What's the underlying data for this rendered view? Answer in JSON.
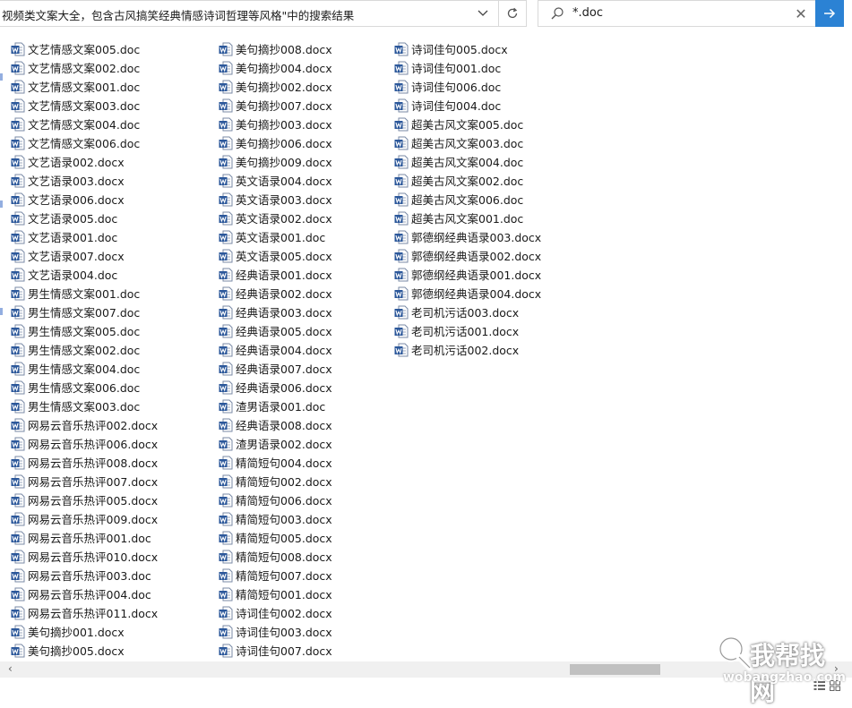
{
  "address_bar": {
    "path_text": "视频类文案大全，包含古风搞笑经典情感诗词哲理等风格\"中的搜索结果",
    "dropdown_icon": "chevron-down-icon",
    "refresh_icon": "refresh-icon"
  },
  "search": {
    "icon": "search-icon",
    "query": "*.doc",
    "clear_icon": "close-icon",
    "go_icon": "arrow-right-icon",
    "go_color": "#2b82d4"
  },
  "file_icon": {
    "name": "word-document-icon",
    "color": "#2b579a"
  },
  "columns": [
    {
      "files": [
        "文艺情感文案005.doc",
        "文艺情感文案002.doc",
        "文艺情感文案001.doc",
        "文艺情感文案003.doc",
        "文艺情感文案004.doc",
        "文艺情感文案006.doc",
        "文艺语录002.docx",
        "文艺语录003.docx",
        "文艺语录006.docx",
        "文艺语录005.doc",
        "文艺语录001.doc",
        "文艺语录007.docx",
        "文艺语录004.doc",
        "男生情感文案001.doc",
        "男生情感文案007.doc",
        "男生情感文案005.doc",
        "男生情感文案002.doc",
        "男生情感文案004.doc",
        "男生情感文案006.doc",
        "男生情感文案003.doc",
        "网易云音乐热评002.docx",
        "网易云音乐热评006.docx",
        "网易云音乐热评008.docx",
        "网易云音乐热评007.docx",
        "网易云音乐热评005.docx",
        "网易云音乐热评009.docx",
        "网易云音乐热评001.doc",
        "网易云音乐热评010.docx",
        "网易云音乐热评003.doc",
        "网易云音乐热评004.doc",
        "网易云音乐热评011.docx",
        "美句摘抄001.docx",
        "美句摘抄005.docx"
      ]
    },
    {
      "files": [
        "美句摘抄008.docx",
        "美句摘抄004.docx",
        "美句摘抄002.docx",
        "美句摘抄007.docx",
        "美句摘抄003.docx",
        "美句摘抄006.docx",
        "美句摘抄009.docx",
        "英文语录004.docx",
        "英文语录003.docx",
        "英文语录002.docx",
        "英文语录001.doc",
        "英文语录005.docx",
        "经典语录001.docx",
        "经典语录002.docx",
        "经典语录003.docx",
        "经典语录005.docx",
        "经典语录004.docx",
        "经典语录007.docx",
        "经典语录006.docx",
        "渣男语录001.doc",
        "经典语录008.docx",
        "渣男语录002.docx",
        "精简短句004.docx",
        "精简短句002.docx",
        "精简短句006.docx",
        "精简短句003.docx",
        "精简短句005.docx",
        "精简短句008.docx",
        "精简短句007.docx",
        "精简短句001.docx",
        "诗词佳句002.docx",
        "诗词佳句003.docx",
        "诗词佳句007.docx"
      ]
    },
    {
      "files": [
        "诗词佳句005.docx",
        "诗词佳句001.doc",
        "诗词佳句006.doc",
        "诗词佳句004.doc",
        "超美古风文案005.doc",
        "超美古风文案003.doc",
        "超美古风文案004.doc",
        "超美古风文案002.doc",
        "超美古风文案006.doc",
        "超美古风文案001.doc",
        "郭德纲经典语录003.docx",
        "郭德纲经典语录002.docx",
        "郭德纲经典语录001.docx",
        "郭德纲经典语录004.docx",
        "老司机污话003.docx",
        "老司机污话001.docx",
        "老司机污话002.docx"
      ]
    }
  ],
  "scrollbar": {
    "left_arrow": "‹",
    "right_arrow": "›",
    "position_fraction": 0.67
  },
  "statusbar": {
    "view_icon": "details-view-icon"
  },
  "watermark": {
    "text": "我帮找网",
    "url_text": "wobangzhao.com"
  }
}
